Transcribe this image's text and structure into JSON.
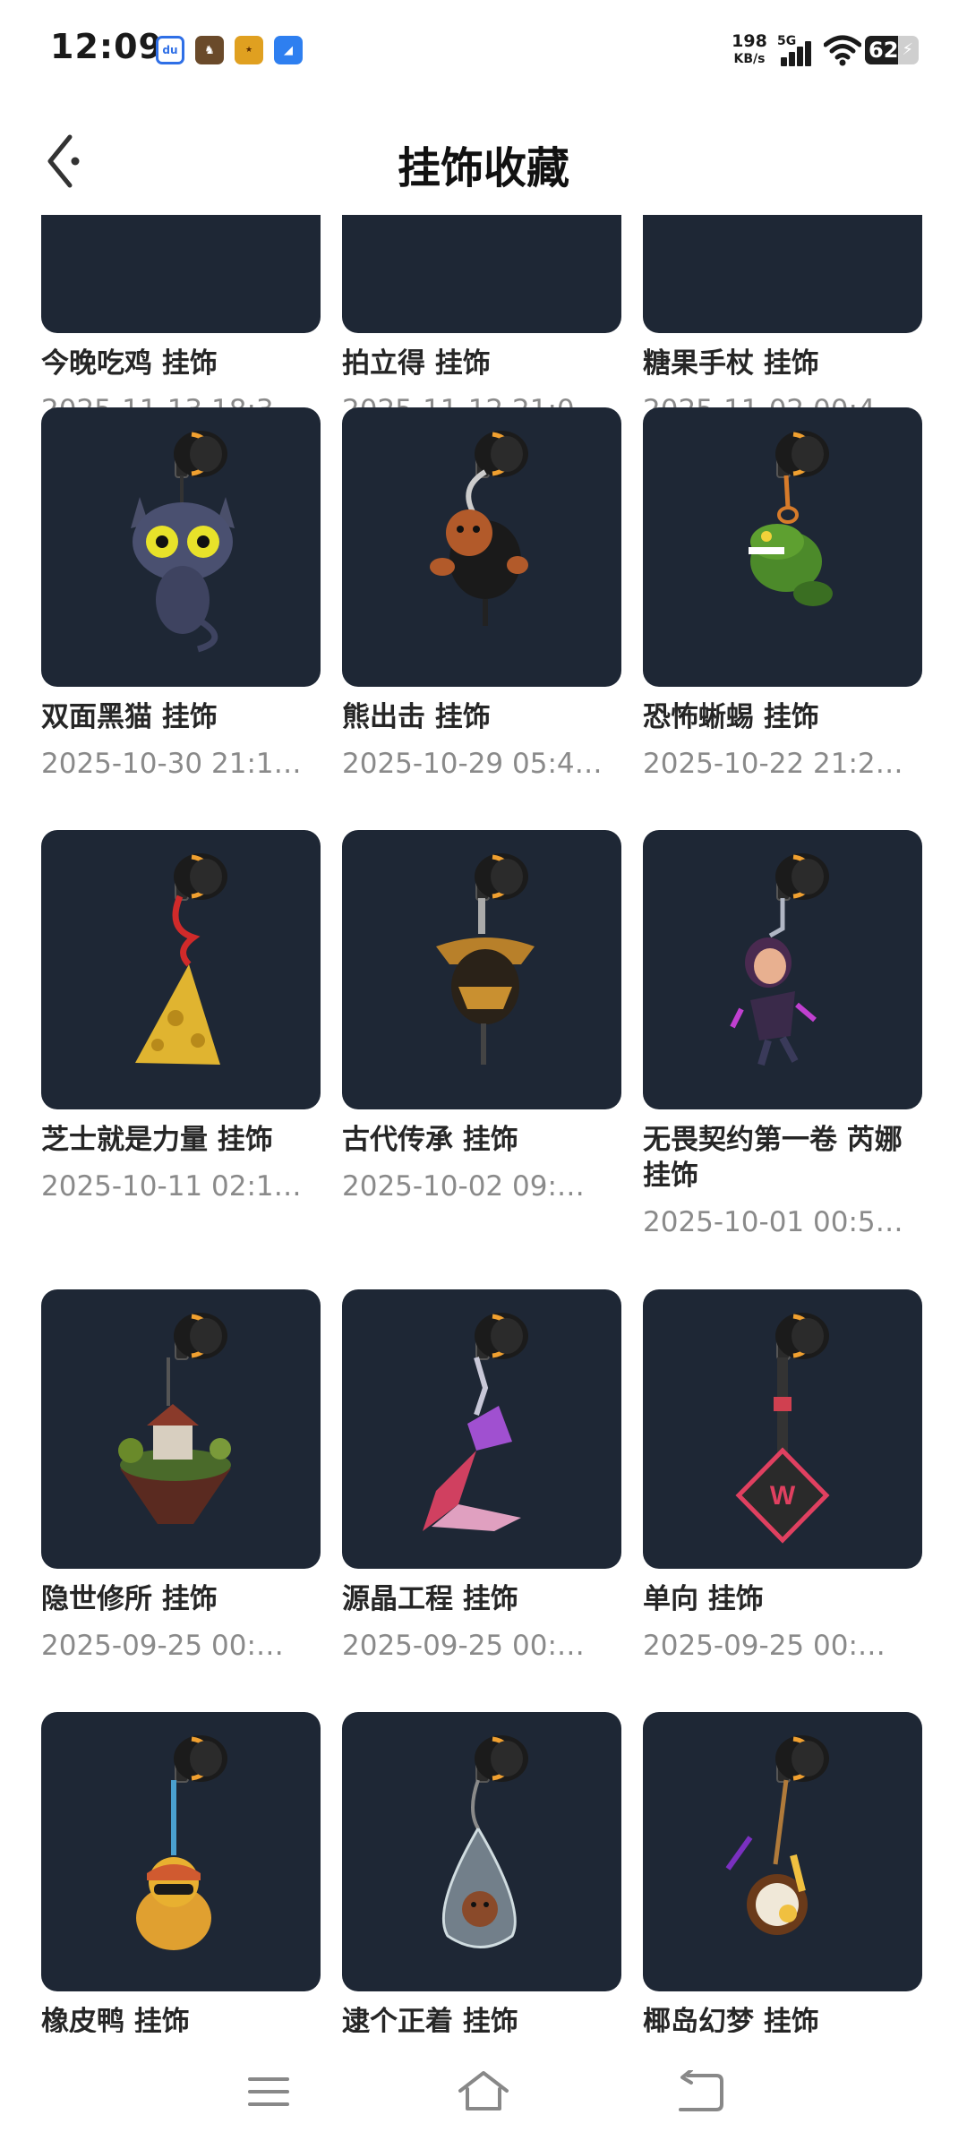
{
  "status_bar": {
    "time": "12:09",
    "app_icons": [
      {
        "name": "baidu-app-icon",
        "glyph": "du"
      },
      {
        "name": "game-app-icon-1",
        "glyph": "♞"
      },
      {
        "name": "game-app-icon-2",
        "glyph": "★"
      },
      {
        "name": "browser-app-icon",
        "glyph": "◢"
      }
    ],
    "net_speed": "198",
    "net_speed_unit": "KB/s",
    "network_type": "5G",
    "battery_level": "62"
  },
  "header": {
    "title": "挂饰收藏",
    "back_icon": "chevron-left-icon"
  },
  "items": [
    {
      "name": "今晚吃鸡 挂饰",
      "date": "2025-11-13 18:3…",
      "charm": "partial"
    },
    {
      "name": "拍立得 挂饰",
      "date": "2025-11-12 21:0…",
      "charm": "partial"
    },
    {
      "name": "糖果手杖 挂饰",
      "date": "2025-11-02 00:4…",
      "charm": "partial"
    },
    {
      "name": "双面黑猫 挂饰",
      "date": "2025-10-30 21:1…",
      "charm": "cat"
    },
    {
      "name": "熊出击 挂饰",
      "date": "2025-10-29 05:4…",
      "charm": "bear"
    },
    {
      "name": "恐怖蜥蜴 挂饰",
      "date": "2025-10-22 21:2…",
      "charm": "lizard"
    },
    {
      "name": "芝士就是力量 挂饰",
      "date": "2025-10-11 02:1…",
      "charm": "cheese"
    },
    {
      "name": "古代传承 挂饰",
      "date": "2025-10-02 09:…",
      "charm": "samurai"
    },
    {
      "name": "无畏契约第一卷 芮娜 挂饰",
      "date": "2025-10-01 00:5…",
      "charm": "reyna"
    },
    {
      "name": "隐世修所 挂饰",
      "date": "2025-09-25 00:…",
      "charm": "island"
    },
    {
      "name": "源晶工程 挂饰",
      "date": "2025-09-25 00:…",
      "charm": "crystal"
    },
    {
      "name": "单向 挂饰",
      "date": "2025-09-25 00:…",
      "charm": "sign"
    },
    {
      "name": "橡皮鸭 挂饰",
      "date": "",
      "charm": "duck"
    },
    {
      "name": "逮个正着 挂饰",
      "date": "",
      "charm": "jar"
    },
    {
      "name": "椰岛幻梦 挂饰",
      "date": "",
      "charm": "coconut"
    }
  ],
  "nav_bar": {
    "menu_icon": "menu-icon",
    "home_icon": "home-icon",
    "back_icon": "back-icon"
  },
  "colors": {
    "thumb_bg": "#1e2735",
    "clasp_accent": "#f0a030",
    "name_text": "#262626",
    "date_text": "#8a8a8a"
  }
}
